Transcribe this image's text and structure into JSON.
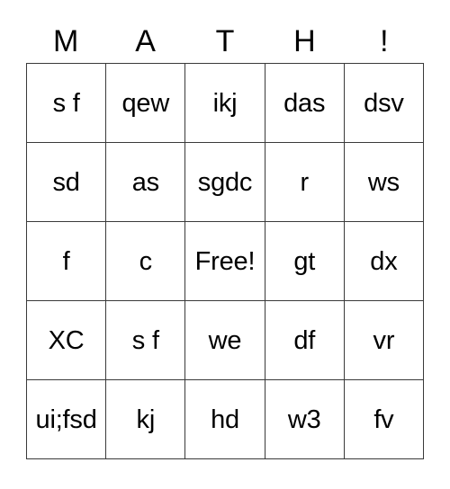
{
  "card": {
    "header_letters": [
      "M",
      "A",
      "T",
      "H",
      "!"
    ],
    "free_space_label": "Free!",
    "rows": [
      [
        "s f",
        "qew",
        "ikj",
        "das",
        "dsv"
      ],
      [
        "sd",
        "as",
        "sgdc",
        "r",
        "ws"
      ],
      [
        "f",
        "c",
        "Free!",
        "gt",
        "dx"
      ],
      [
        "XC",
        "s f",
        "we",
        "df",
        "vr"
      ],
      [
        "ui;fsd",
        "kj",
        "hd",
        "w3",
        "fv"
      ]
    ],
    "colors": {
      "background": "#ffffff",
      "grid_line": "#3a3a3a",
      "text": "#000000"
    }
  }
}
